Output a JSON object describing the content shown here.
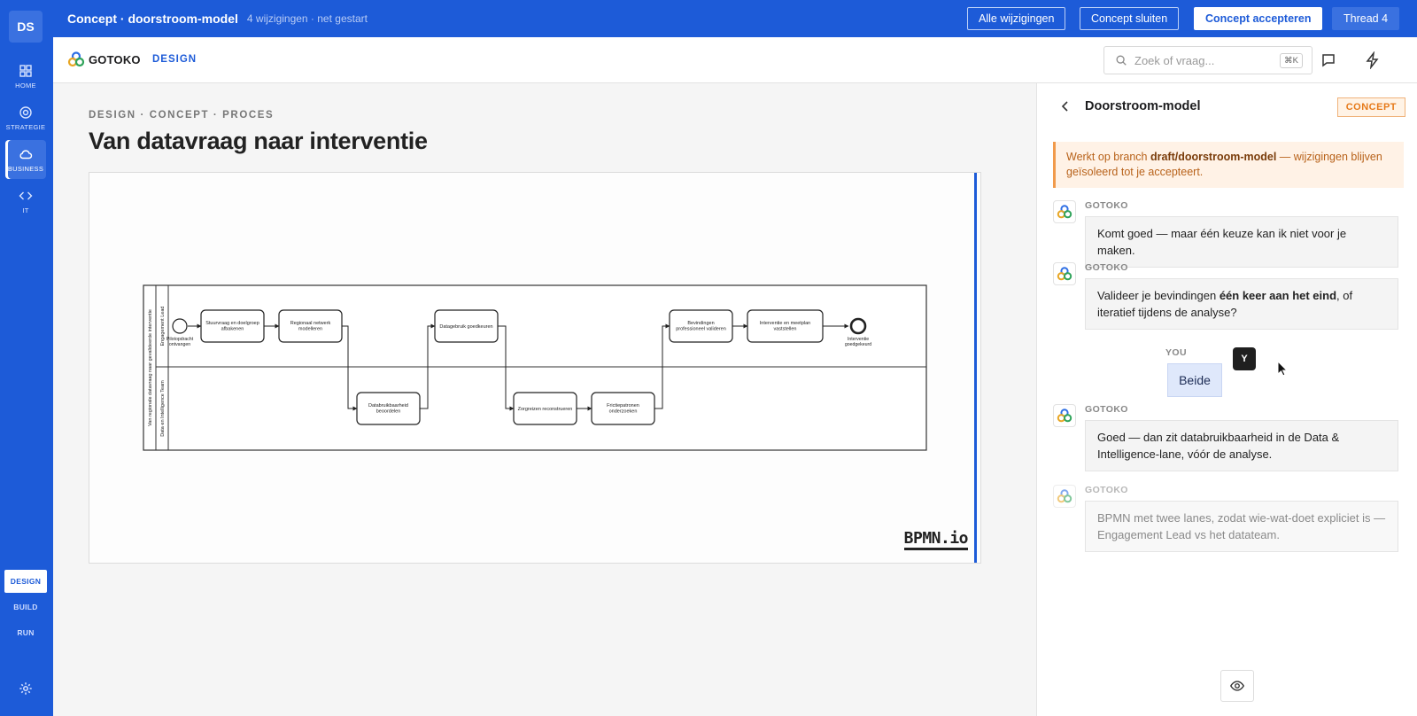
{
  "rail": {
    "avatar": "DS",
    "items": [
      {
        "label": "HOME",
        "icon": "grid-icon"
      },
      {
        "label": "STRATEGIE",
        "icon": "target-icon"
      },
      {
        "label": "BUSINESS",
        "icon": "cloud-icon"
      },
      {
        "label": "IT",
        "icon": "code-icon"
      }
    ],
    "modes": [
      "DESIGN",
      "BUILD",
      "RUN"
    ]
  },
  "topbar": {
    "title": "Concept · doorstroom-model",
    "subtitle": "4 wijzigingen · net gestart",
    "buttons": {
      "all_changes": "Alle wijzigingen",
      "close_concept": "Concept sluiten",
      "accept_concept": "Concept accepteren",
      "thread": "Thread 4"
    }
  },
  "header": {
    "logo": "GOTOKO",
    "section": "DESIGN",
    "search_placeholder": "Zoek of vraag...",
    "search_shortcut": "⌘K"
  },
  "main": {
    "breadcrumb": "DESIGN · CONCEPT · PROCES",
    "title": "Van datavraag naar interventie",
    "bpmn_logo": "BPMN.io",
    "diagram": {
      "pool": "Van regionale datavraag naar gevalideerde interventie",
      "lanes": [
        "Engagement Lead",
        "Data en Intelligence Team"
      ],
      "start_event": [
        "Pilotopdracht",
        "ontvangen"
      ],
      "end_event": [
        "Interventie",
        "goedgekeurd"
      ],
      "tasks": [
        [
          "Stuurvraag en doelgroep",
          "afbakenen"
        ],
        [
          "Regionaal netwerk",
          "modelleren"
        ],
        [
          "Databruikbaarheid",
          "beoordelen"
        ],
        [
          "Datagebruik goedkeuren"
        ],
        [
          "Zorgreizen reconstrueren"
        ],
        [
          "Frictiepatronen",
          "onderzoeken"
        ],
        [
          "Bevindingen",
          "professioneel valideren"
        ],
        [
          "Interventie en meetplan",
          "vaststellen"
        ]
      ]
    }
  },
  "panel": {
    "title": "Doorstroom-model",
    "badge": "CONCEPT",
    "warning_pre": "Werkt op branch ",
    "warning_branch": "draft/doorstroom-model",
    "warning_post": " — wijzigingen blijven geïsoleerd tot je accepteert.",
    "bot_name": "GOTOKO",
    "you_name": "YOU",
    "you_avatar": "Y",
    "msg1": "Komt goed — maar één keuze kan ik niet voor je maken.",
    "msg2_pre": "Valideer je bevindingen ",
    "msg2_bold": "één keer aan het eind",
    "msg2_post": ", of iteratief tijdens de analyse?",
    "you_reply": "Beide",
    "msg3": "Goed — dan zit databruikbaarheid in de Data & Intelligence-lane, vóór de analyse.",
    "msg4": "BPMN met twee lanes, zodat wie-wat-doet expliciet is — Engagement Lead vs het datateam."
  }
}
